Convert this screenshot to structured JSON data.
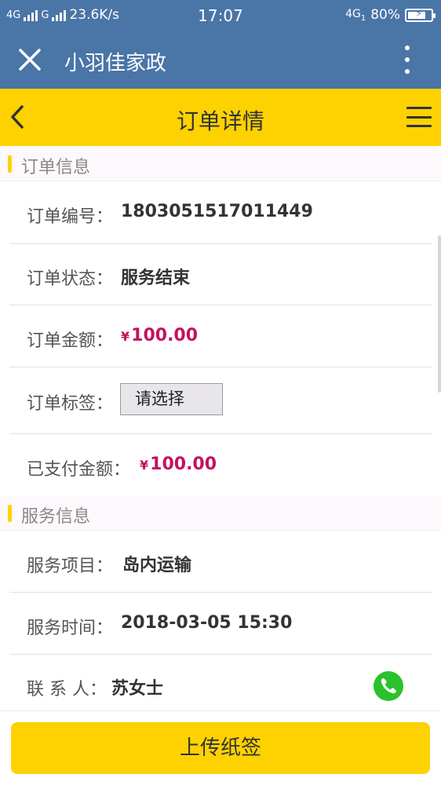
{
  "status_bar": {
    "net1": "4G",
    "net2": "G",
    "speed": "23.6K/s",
    "time": "17:07",
    "net3": "4G",
    "net3_sub": "1",
    "battery_percent": 80,
    "battery_text": "80%"
  },
  "title_bar": {
    "close_icon": "close-icon",
    "title": "小羽佳家政",
    "more_icon": "more-vertical-icon"
  },
  "header": {
    "back_icon": "chevron-left-icon",
    "title": "订单详情",
    "menu_icon": "menu-icon"
  },
  "order_section": {
    "title": "订单信息",
    "order_no_label": "订单编号：",
    "order_no": "1803051517011449",
    "status_label": "订单状态：",
    "status": "服务结束",
    "amount_label": "订单金额：",
    "currency": "¥",
    "amount": "100.00",
    "tag_label": "订单标签：",
    "tag_select": "请选择",
    "paid_label": "已支付金额：",
    "paid": "100.00"
  },
  "service_section": {
    "title": "服务信息",
    "item_label": "服务项目：",
    "item": "岛内运输",
    "time_label": "服务时间：",
    "time": "2018-03-05 15:30",
    "contact_label": "联 系 人：",
    "contact": "苏女士",
    "phone_icon": "phone-icon"
  },
  "footer": {
    "upload_button": "上传纸签"
  },
  "colors": {
    "status_blue": "#4a75a7",
    "header_yellow": "#fdd200",
    "price_red": "#c4115f",
    "phone_green": "#2bc12b"
  }
}
